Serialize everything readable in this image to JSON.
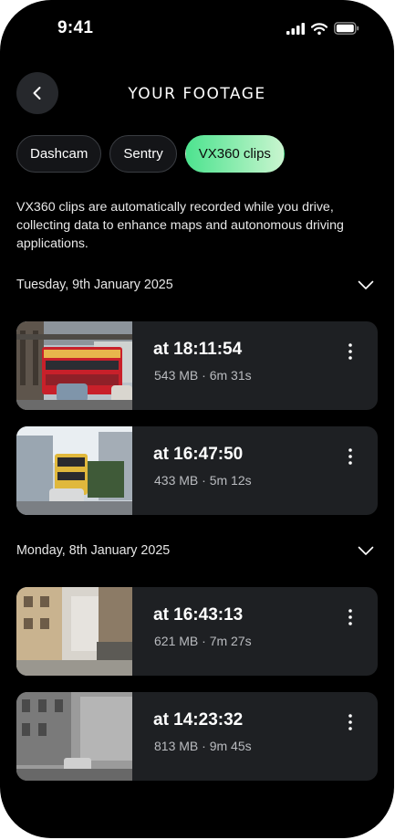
{
  "status_bar": {
    "time": "9:41"
  },
  "header": {
    "title": "YOUR FOOTAGE"
  },
  "tabs": [
    {
      "label": "Dashcam",
      "active": false
    },
    {
      "label": "Sentry",
      "active": false
    },
    {
      "label": "VX360 clips",
      "active": true
    }
  ],
  "description": "VX360 clips are automatically recorded while you drive, collecting data to enhance maps and autonomous driving applications.",
  "groups": [
    {
      "date": "Tuesday, 9th January 2025",
      "clips": [
        {
          "time": "at 18:11:54",
          "meta": "543 MB  · 6m 31s"
        },
        {
          "time": "at 16:47:50",
          "meta": "433 MB · 5m 12s"
        }
      ]
    },
    {
      "date": "Monday, 8th January 2025",
      "clips": [
        {
          "time": "at 16:43:13",
          "meta": "621 MB · 7m 27s"
        },
        {
          "time": "at 14:23:32",
          "meta": "813 MB · 9m 45s"
        }
      ]
    }
  ],
  "colors": {
    "background": "#000000",
    "card": "#1e2023",
    "accent_start": "#4de38f",
    "accent_end": "#c9f5cf"
  },
  "icons": [
    "back-arrow-icon",
    "signal-icon",
    "wifi-icon",
    "battery-icon",
    "chevron-down-icon",
    "more-vertical-icon"
  ]
}
